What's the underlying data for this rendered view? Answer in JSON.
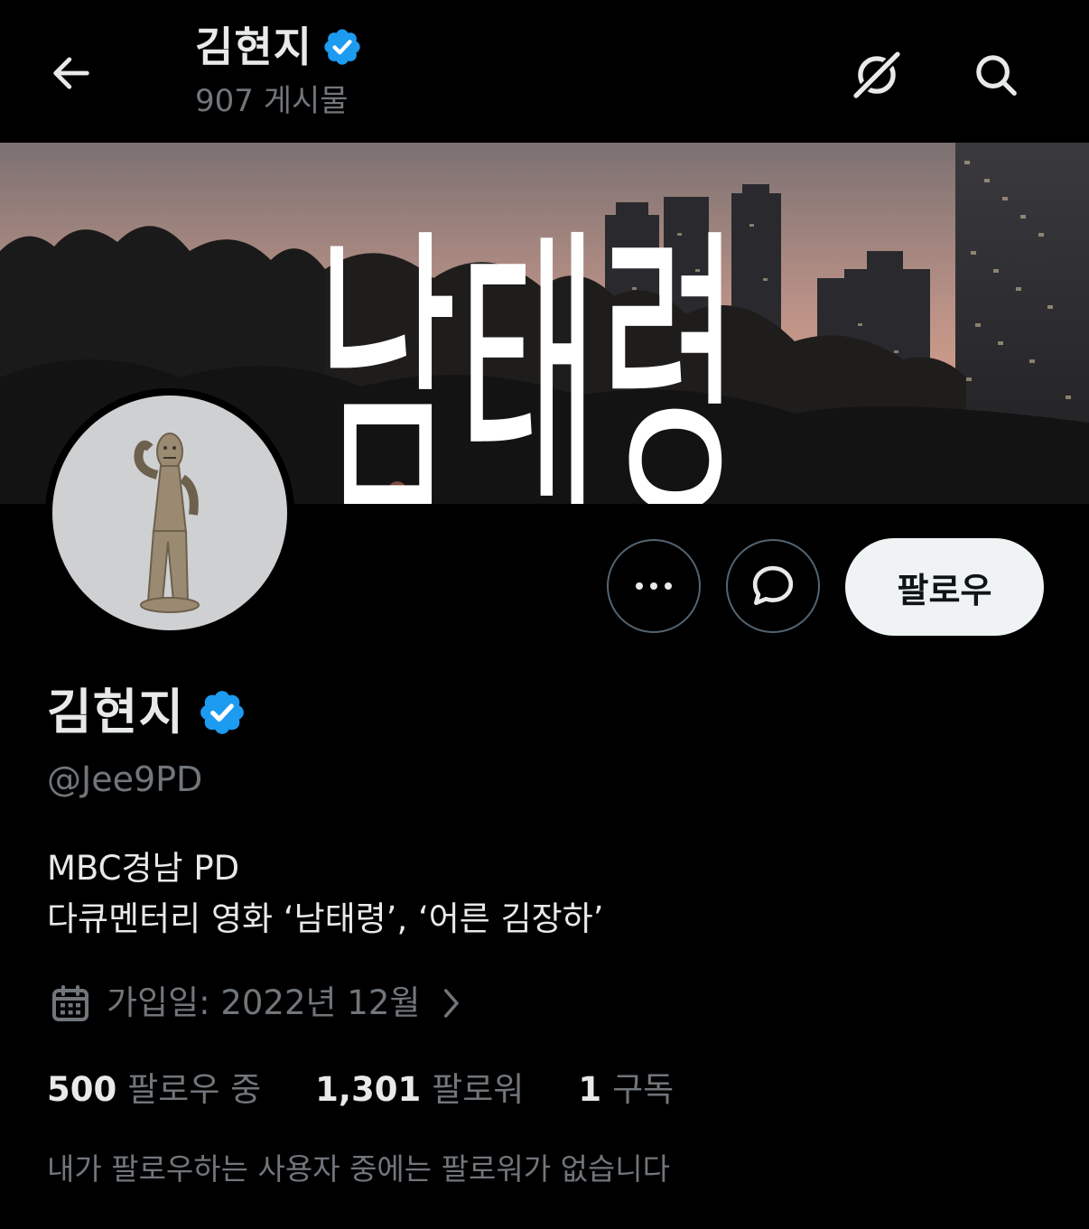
{
  "header": {
    "name": "김현지",
    "posts_count": "907 게시물",
    "back_icon": "arrow-left-icon",
    "grok_icon": "grok-icon",
    "search_icon": "search-icon"
  },
  "banner": {
    "title_text": "남태령"
  },
  "actions": {
    "more_icon": "more-dots-icon",
    "message_icon": "message-bubble-icon",
    "follow_label": "팔로우"
  },
  "profile": {
    "name": "김현지",
    "verified": true,
    "handle": "@Jee9PD",
    "bio_lines": [
      "MBC경남 PD",
      "다큐멘터리 영화 ‘남태령’, ‘어른 김장하’"
    ],
    "joined": "가입일: 2022년 12월"
  },
  "stats": {
    "following_count": "500",
    "following_label": "팔로우 중",
    "followers_count": "1,301",
    "followers_label": "팔로워",
    "subscriptions_count": "1",
    "subscriptions_label": "구독"
  },
  "mutual_note": "내가 팔로우하는 사용자 중에는 팔로워가 없습니다",
  "colors": {
    "background": "#000000",
    "text_primary": "#e7e9ea",
    "text_secondary": "#71767b",
    "verified_badge": "#1d9bf0",
    "follow_button_bg": "#eff3f4"
  }
}
